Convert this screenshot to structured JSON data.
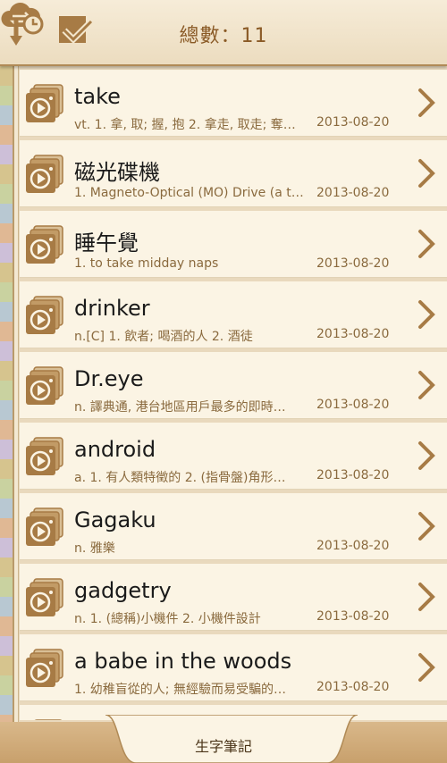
{
  "header": {
    "title": "總數：11",
    "icons": [
      "sort-by-time-icon",
      "select-all-icon",
      "cloud-sync-icon"
    ]
  },
  "colors": {
    "accent": "#8a5a26",
    "icon_brown": "#a77b45",
    "row_bg": "#fbf4e4",
    "tab_bg": "#c8a06c"
  },
  "words": [
    {
      "word": "take",
      "definition": "vt.  1. 拿, 取; 握, 抱  2. 拿走, 取走; 奪…",
      "date": "2013-08-20"
    },
    {
      "word": "磁光碟機",
      "definition": "1. Magneto-Optical (MO) Drive (a t…",
      "date": "2013-08-20"
    },
    {
      "word": "睡午覺",
      "definition": "1. to take midday naps",
      "date": "2013-08-20"
    },
    {
      "word": "drinker",
      "definition": "n.[C]  1. 飲者; 喝酒的人  2. 酒徒",
      "date": "2013-08-20"
    },
    {
      "word": "Dr.eye",
      "definition": "n.  譯典通, 港台地區用戶最多的即時…",
      "date": "2013-08-20"
    },
    {
      "word": "android",
      "definition": "a.  1. 有人類特徵的  2. (指骨盤)角形…",
      "date": "2013-08-20"
    },
    {
      "word": "Gagaku",
      "definition": "n.  雅樂",
      "date": "2013-08-20"
    },
    {
      "word": "gadgetry",
      "definition": "n.  1. (總稱)小機件  2. 小機件設計",
      "date": "2013-08-20"
    },
    {
      "word": "a babe in the woods",
      "definition": "1. 幼稚盲從的人; 無經驗而易受騙的…",
      "date": "2013-08-20"
    },
    {
      "word": "",
      "definition": "",
      "date": ""
    }
  ],
  "bottom_tab": {
    "label": "生字筆記"
  }
}
